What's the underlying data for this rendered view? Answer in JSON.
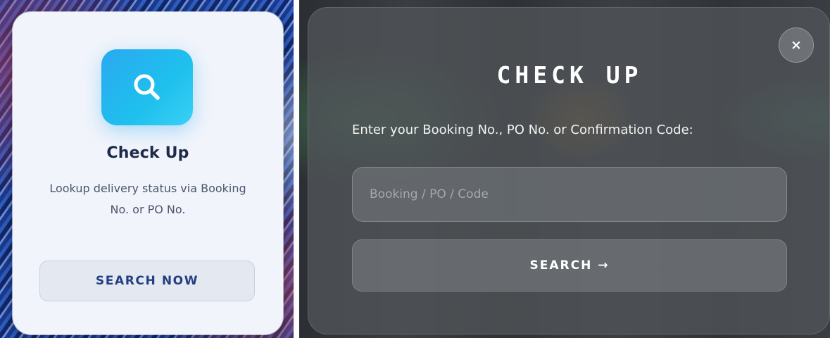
{
  "lookup_card": {
    "icon": "search-icon",
    "title": "Check Up",
    "description": "Lookup delivery status via Booking No. or PO No.",
    "button_label": "SEARCH NOW"
  },
  "checkup_modal": {
    "close_label": "×",
    "title": "CHECK UP",
    "prompt": "Enter your Booking No., PO No. or Confirmation Code:",
    "input": {
      "value": "",
      "placeholder": "Booking / PO / Code"
    },
    "search_label": "SEARCH →"
  },
  "colors": {
    "tile_accent": "#1fc0ee",
    "button_text": "#233f82",
    "title_text": "#1d2a4a",
    "modal_bg": "#505458"
  }
}
